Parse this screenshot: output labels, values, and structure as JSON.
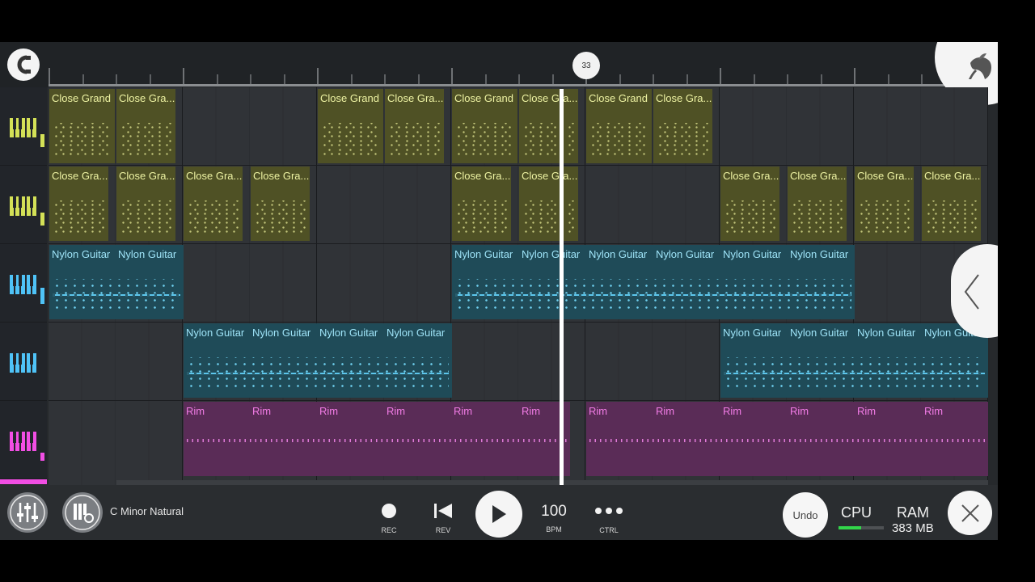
{
  "ruler": {
    "position_marker": "33"
  },
  "tracks": [
    {
      "color": "#d4e157",
      "clips": [
        {
          "label": "Close Grand"
        },
        {
          "label": "Close Gra..."
        },
        {
          "label": "Close Grand"
        },
        {
          "label": "Close Gra..."
        },
        {
          "label": "Close Grand"
        },
        {
          "label": "Close Gra..."
        },
        {
          "label": "Close Grand"
        },
        {
          "label": "Close Gra..."
        }
      ]
    },
    {
      "color": "#d4e157",
      "clips": [
        {
          "label": "Close Gra..."
        },
        {
          "label": "Close Gra..."
        },
        {
          "label": "Close Gra..."
        },
        {
          "label": "Close Gra..."
        },
        {
          "label": "Close Gra..."
        },
        {
          "label": "Close Gra..."
        },
        {
          "label": "Close Gra..."
        },
        {
          "label": "Close Gra..."
        },
        {
          "label": "Close Gra..."
        },
        {
          "label": "Close Gra..."
        }
      ]
    },
    {
      "color": "#4fc3f7",
      "clips": [
        {
          "label": "Nylon Guitar"
        },
        {
          "label": "Nylon Guitar"
        },
        {
          "label": "Nylon Guitar"
        },
        {
          "label": "Nylon Guitar"
        },
        {
          "label": "Nylon Guitar"
        },
        {
          "label": "Nylon Guitar"
        },
        {
          "label": "Nylon Guitar"
        },
        {
          "label": "Nylon Guitar"
        }
      ]
    },
    {
      "color": "#4fc3f7",
      "clips": [
        {
          "label": "Nylon Guitar"
        },
        {
          "label": "Nylon Guitar"
        },
        {
          "label": "Nylon Guitar"
        },
        {
          "label": "Nylon Guitar"
        },
        {
          "label": "Nylon Guitar"
        },
        {
          "label": "Nylon Guitar"
        },
        {
          "label": "Nylon Guitar"
        },
        {
          "label": "Nylon Guitar"
        }
      ]
    },
    {
      "color": "#f24ee4",
      "clips": [
        {
          "label": "Rim"
        },
        {
          "label": "Rim"
        },
        {
          "label": "Rim"
        },
        {
          "label": "Rim"
        },
        {
          "label": "Rim"
        },
        {
          "label": "Rim"
        },
        {
          "label": "Rim"
        },
        {
          "label": "Rim"
        },
        {
          "label": "Rim"
        },
        {
          "label": "Rim"
        },
        {
          "label": "Rim"
        },
        {
          "label": "Rim"
        }
      ]
    }
  ],
  "toolbar": {
    "scale": "C Minor Natural",
    "rec_label": "REC",
    "rev_label": "REV",
    "bpm_value": "100",
    "bpm_label": "BPM",
    "ctrl_label": "CTRL",
    "undo_label": "Undo",
    "cpu_label": "CPU",
    "cpu_load_percent": 50,
    "ram_label": "RAM",
    "ram_value": "383 MB"
  },
  "icons": {
    "magnet": "magnet-icon",
    "logo": "fruit-logo-icon",
    "mixer": "mixer-sliders-icon",
    "piano_settings": "piano-settings-icon",
    "record": "record-icon",
    "rewind": "skip-back-icon",
    "play": "play-icon",
    "more": "more-dots-icon",
    "close": "close-icon",
    "panel": "chevron-left-icon",
    "piano": "piano-keys-icon"
  }
}
